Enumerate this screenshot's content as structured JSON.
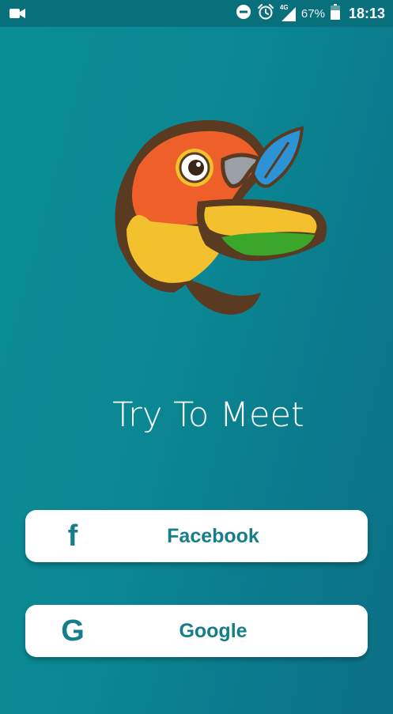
{
  "status_bar": {
    "battery_percent": "67%",
    "time": "18:13",
    "network": "4G"
  },
  "app": {
    "title": "Try To Meet"
  },
  "buttons": {
    "facebook": {
      "icon": "f",
      "label": "Facebook"
    },
    "google": {
      "icon": "G",
      "label": "Google"
    }
  },
  "icons": {
    "status_left": "video-camera-icon",
    "dnd": "do-not-disturb-icon",
    "alarm": "alarm-clock-icon",
    "signal": "cellular-signal-icon",
    "battery": "battery-icon",
    "logo": "parrot-logo"
  },
  "colors": {
    "background": "#0b8793",
    "status_bar": "#08707b",
    "button_text": "#167e8b",
    "button_bg": "#ffffff"
  }
}
